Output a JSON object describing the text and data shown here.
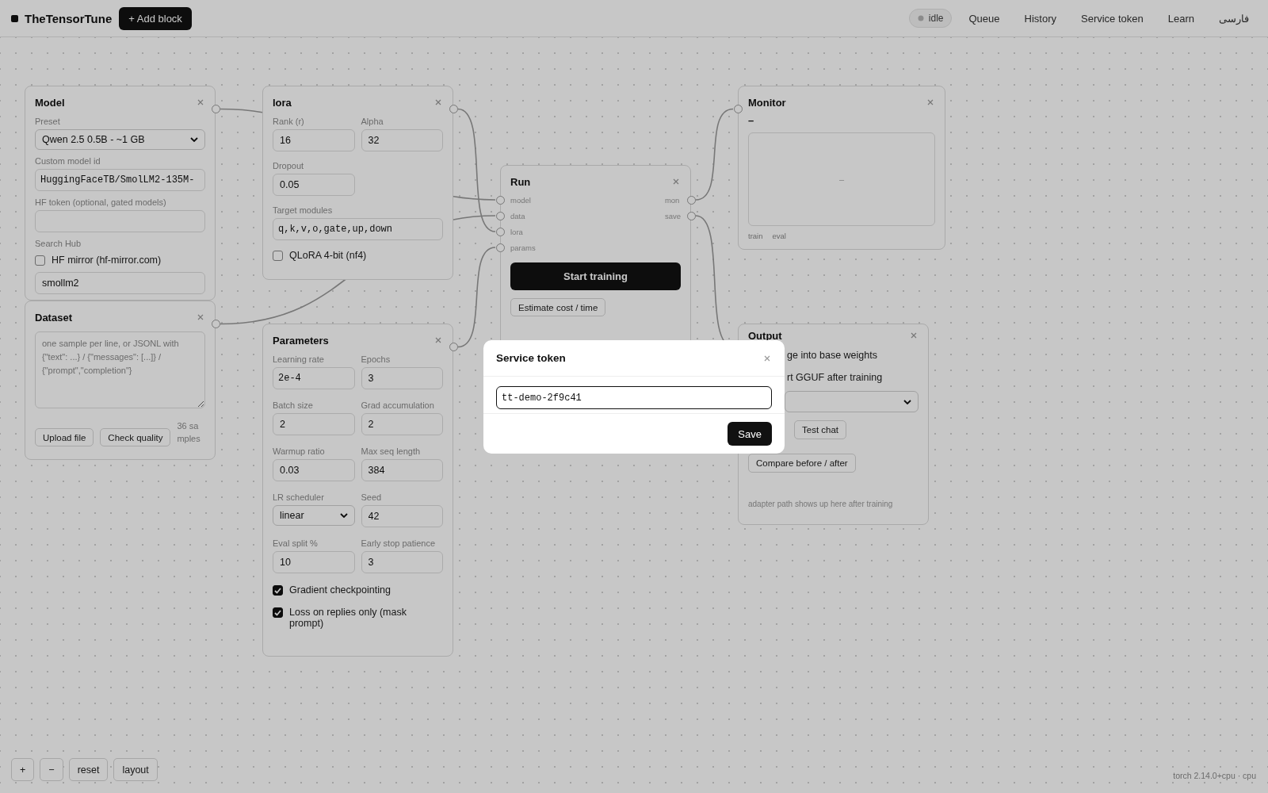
{
  "header": {
    "logo": "TheTensorTune",
    "add_block": "+ Add block",
    "status": "idle",
    "nav": [
      "Queue",
      "History",
      "Service token",
      "Learn",
      "فارسی"
    ]
  },
  "nodes": [
    {
      "kind": "model",
      "title": "Model",
      "items": [
        {
          "kind": "select",
          "label": "Preset",
          "value": "Qwen 2.5 0.5B - ~1 GB"
        },
        {
          "kind": "input",
          "label": "Custom model id",
          "value": "HuggingFaceTB/SmolLM2-135M-",
          "mono": true
        },
        {
          "kind": "input",
          "label": "HF token (optional, gated models)"
        },
        {
          "kind": "label",
          "text": "Search Hub"
        },
        {
          "kind": "checkbox",
          "label": "HF mirror (hf-mirror.com)",
          "checked": false
        },
        {
          "kind": "input",
          "value": "smollm2"
        }
      ]
    },
    {
      "kind": "dataset",
      "title": "Dataset",
      "items": [
        {
          "kind": "textarea",
          "placeholder": "one sample per line, or JSONL with {\"text\": ...} / {\"messages\": [...]} / {\"prompt\",\"completion\"}"
        },
        {
          "kind": "buttons",
          "buttons": [
            "Upload file",
            "Check quality"
          ],
          "note": "36 samples"
        }
      ]
    },
    {
      "kind": "lora",
      "title": "lora",
      "items": [
        {
          "kind": "pair",
          "fields": [
            {
              "kind": "input",
              "label": "Rank (r)",
              "value": "16"
            },
            {
              "kind": "input",
              "label": "Alpha",
              "value": "32"
            }
          ]
        },
        {
          "kind": "pair",
          "fields": [
            {
              "kind": "input",
              "label": "Dropout",
              "value": "0.05"
            }
          ]
        },
        {
          "kind": "input",
          "label": "Target modules",
          "value": "q,k,v,o,gate,up,down",
          "mono": true
        },
        {
          "kind": "checkbox",
          "label": "QLoRA 4-bit (nf4)",
          "checked": false
        }
      ]
    },
    {
      "kind": "params",
      "title": "Parameters",
      "items": [
        {
          "kind": "pair",
          "fields": [
            {
              "kind": "input",
              "label": "Learning rate",
              "value": "2e-4",
              "mono": true
            },
            {
              "kind": "input",
              "label": "Epochs",
              "value": "3"
            }
          ]
        },
        {
          "kind": "pair",
          "fields": [
            {
              "kind": "input",
              "label": "Batch size",
              "value": "2"
            },
            {
              "kind": "input",
              "label": "Grad accumulation",
              "value": "2"
            }
          ]
        },
        {
          "kind": "pair",
          "fields": [
            {
              "kind": "input",
              "label": "Warmup ratio",
              "value": "0.03"
            },
            {
              "kind": "input",
              "label": "Max seq length",
              "value": "384"
            }
          ]
        },
        {
          "kind": "pair",
          "fields": [
            {
              "kind": "select",
              "label": "LR scheduler",
              "value": "linear"
            },
            {
              "kind": "input",
              "label": "Seed",
              "value": "42"
            }
          ]
        },
        {
          "kind": "pair",
          "fields": [
            {
              "kind": "input",
              "label": "Eval split %",
              "value": "10"
            },
            {
              "kind": "input",
              "label": "Early stop patience",
              "value": "3"
            }
          ]
        },
        {
          "kind": "checkbox",
          "label": "Gradient checkpointing",
          "checked": true
        },
        {
          "kind": "checkbox",
          "label": "Loss on replies only (mask prompt)",
          "checked": true
        }
      ]
    },
    {
      "kind": "run",
      "title": "Run",
      "items": [
        {
          "kind": "ports",
          "inputs": [
            "model",
            "data",
            "lora",
            "params"
          ],
          "outputs": [
            "mon",
            "save"
          ]
        },
        {
          "kind": "primary",
          "text": "Start training"
        },
        {
          "kind": "buttons",
          "buttons": [
            "Estimate cost / time"
          ]
        }
      ]
    },
    {
      "kind": "monitor",
      "title": "Monitor",
      "items": [
        {
          "kind": "value",
          "text": "–"
        },
        {
          "kind": "chart",
          "text": "–"
        },
        {
          "kind": "legend",
          "labels": [
            "train",
            "eval"
          ]
        }
      ]
    },
    {
      "kind": "output",
      "title": "Output",
      "items": [
        {
          "kind": "peek_text",
          "text": "ge into base weights"
        },
        {
          "kind": "peek_text",
          "text": "rt GGUF after training"
        },
        {
          "kind": "peek_select"
        },
        {
          "kind": "peek_buttons",
          "buttons": [
            "Test chat"
          ]
        },
        {
          "kind": "buttons",
          "buttons": [
            "Compare before / after"
          ]
        },
        {
          "kind": "hint",
          "text": "adapter path shows up here after training"
        }
      ]
    }
  ],
  "zoom_controls": [
    "+",
    "−",
    "reset",
    "layout"
  ],
  "footer": "torch 2.14.0+cpu · cpu",
  "modal": {
    "title": "Service token",
    "value": "tt-demo-2f9c41",
    "button": "Save"
  }
}
